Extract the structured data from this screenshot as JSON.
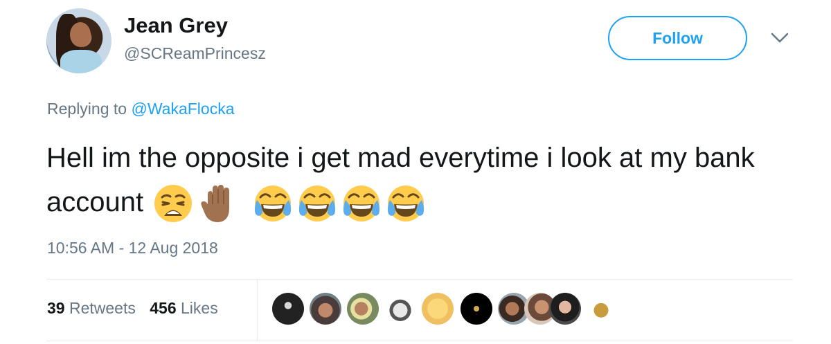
{
  "tweet": {
    "author": {
      "display_name": "Jean Grey",
      "handle": "@SCReamPrincesz",
      "avatar_icon": "user-avatar"
    },
    "follow_label": "Follow",
    "more_icon": "chevron-down-icon",
    "replying_prefix": "Replying to",
    "replying_to": "@WakaFlocka",
    "text": "Hell im the opposite i get mad everytime i look at my bank account",
    "emojis": [
      "weary-face",
      "raised-hand-medium-dark-skin",
      "face-with-tears-of-joy",
      "face-with-tears-of-joy",
      "face-with-tears-of-joy",
      "face-with-tears-of-joy"
    ],
    "timestamp": "10:56 AM - 12 Aug 2018",
    "stats": {
      "retweets_count": "39",
      "retweets_label": "Retweets",
      "likes_count": "456",
      "likes_label": "Likes"
    },
    "likers": [
      "liker-1",
      "liker-2",
      "liker-3",
      "liker-4",
      "liker-5",
      "liker-6",
      "liker-7",
      "liker-8",
      "liker-9",
      "liker-10"
    ]
  },
  "colors": {
    "accent": "#1da1f2",
    "secondary_text": "#657786",
    "primary_text": "#14171a",
    "divider": "#e6ecf0"
  }
}
